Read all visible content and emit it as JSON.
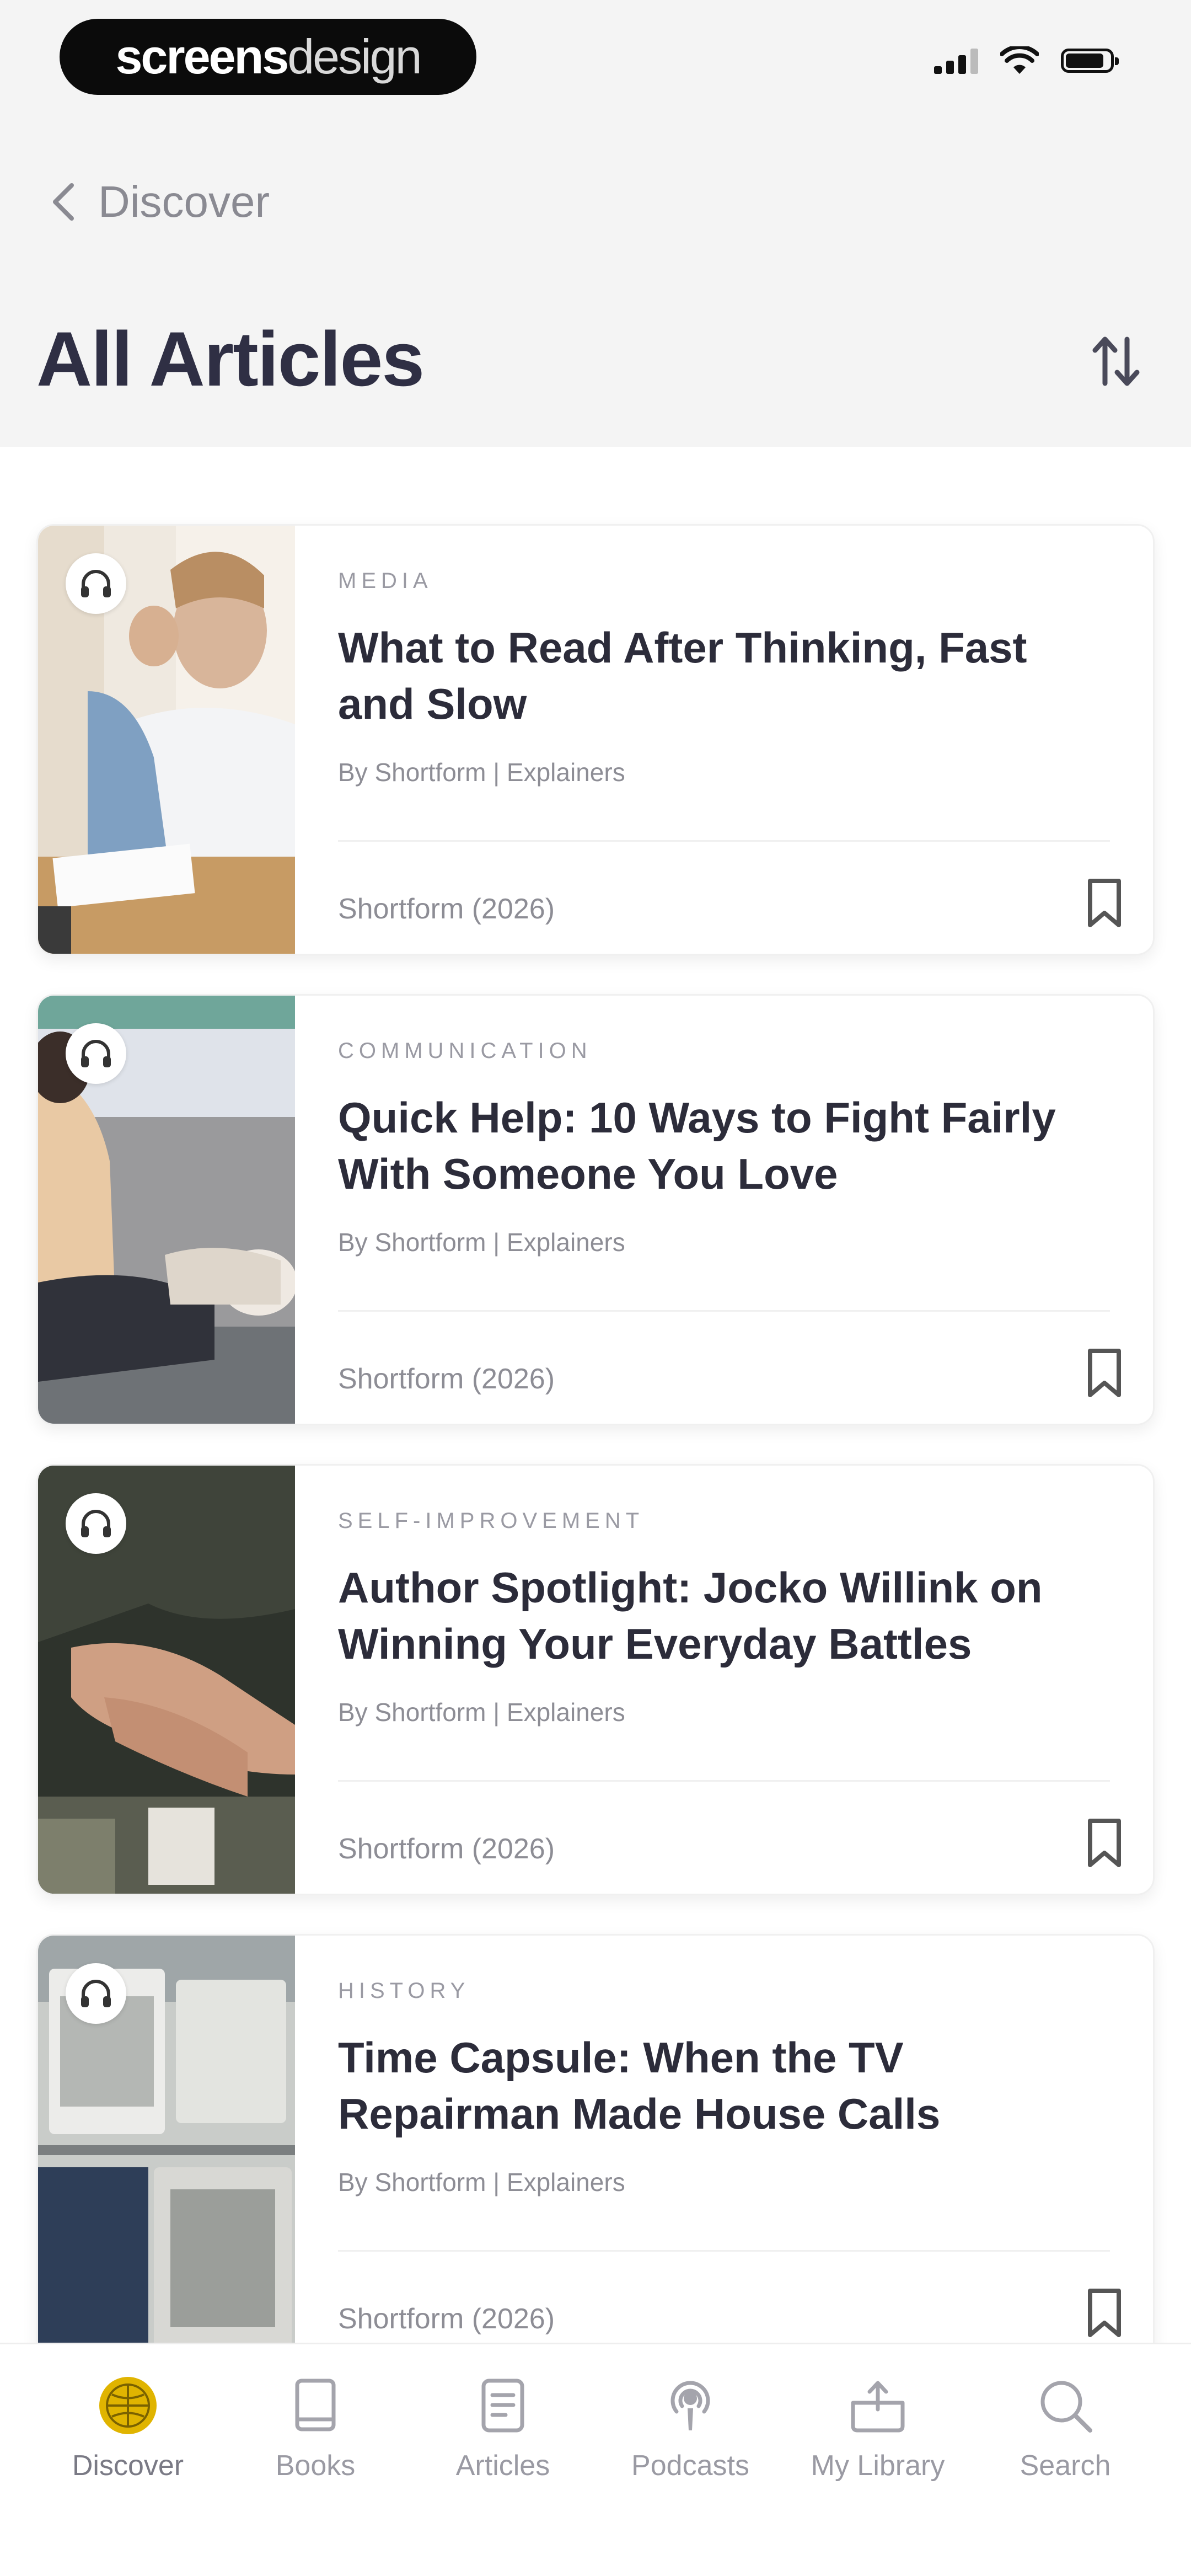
{
  "status_bar": {
    "brand_bold": "screens",
    "brand_light": "design"
  },
  "header": {
    "back_label": "Discover",
    "title": "All Articles"
  },
  "articles": [
    {
      "category": "MEDIA",
      "title": "What to Read After Thinking, Fast and Slow",
      "byline": "By Shortform | Explainers",
      "source": "Shortform (2026)"
    },
    {
      "category": "COMMUNICATION",
      "title": "Quick Help: 10 Ways to Fight Fairly With Someone You Love",
      "byline": "By Shortform | Explainers",
      "source": "Shortform (2026)"
    },
    {
      "category": "SELF-IMPROVEMENT",
      "title": "Author Spotlight: Jocko Willink on Winning Your Everyday Battles",
      "byline": "By Shortform | Explainers",
      "source": "Shortform (2026)"
    },
    {
      "category": "HISTORY",
      "title": "Time Capsule: When the TV Repairman Made House Calls",
      "byline": "By Shortform | Explainers",
      "source": "Shortform (2026)"
    }
  ],
  "tabbar": {
    "tabs": [
      {
        "label": "Discover",
        "icon": "discover-icon",
        "active": true
      },
      {
        "label": "Books",
        "icon": "book-icon",
        "active": false
      },
      {
        "label": "Articles",
        "icon": "article-icon",
        "active": false
      },
      {
        "label": "Podcasts",
        "icon": "podcast-icon",
        "active": false
      },
      {
        "label": "My Library",
        "icon": "library-icon",
        "active": false
      },
      {
        "label": "Search",
        "icon": "search-icon",
        "active": false
      }
    ]
  },
  "colors": {
    "accent": "#e0b400",
    "title_text": "#2f2f44",
    "muted_text": "#8d8d95"
  }
}
